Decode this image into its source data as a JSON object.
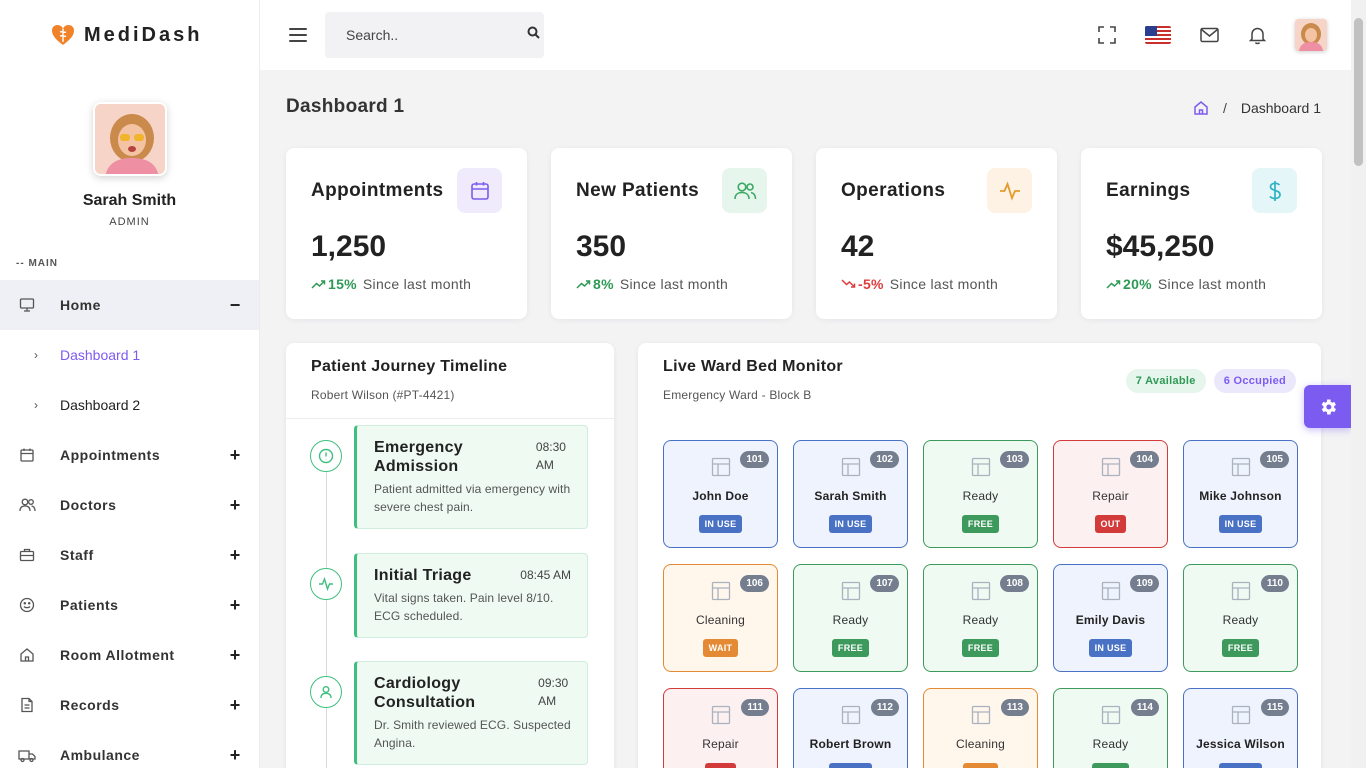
{
  "brand": {
    "name": "MediDash"
  },
  "profile": {
    "name": "Sarah Smith",
    "role": "ADMIN"
  },
  "sidebar": {
    "section_label": "-- MAIN",
    "home": {
      "label": "Home",
      "toggle": "−",
      "sub": [
        {
          "label": "Dashboard 1"
        },
        {
          "label": "Dashboard 2"
        }
      ]
    },
    "items": [
      {
        "label": "Appointments",
        "toggle": "+"
      },
      {
        "label": "Doctors",
        "toggle": "+"
      },
      {
        "label": "Staff",
        "toggle": "+"
      },
      {
        "label": "Patients",
        "toggle": "+"
      },
      {
        "label": "Room Allotment",
        "toggle": "+"
      },
      {
        "label": "Records",
        "toggle": "+"
      },
      {
        "label": "Ambulance",
        "toggle": "+"
      }
    ]
  },
  "header": {
    "search_placeholder": "Search.."
  },
  "page": {
    "title": "Dashboard 1",
    "breadcrumb_current": "Dashboard 1",
    "breadcrumb_sep": "/"
  },
  "stats": [
    {
      "title": "Appointments",
      "value": "1,250",
      "change": "15%",
      "direction": "up",
      "since": "Since last month",
      "icon": "calendar-icon",
      "color": "#7c5cf0",
      "bg": "#efebfd"
    },
    {
      "title": "New Patients",
      "value": "350",
      "change": "8%",
      "direction": "up",
      "since": "Since last month",
      "icon": "users-icon",
      "color": "#3aa865",
      "bg": "#e7f6ec"
    },
    {
      "title": "Operations",
      "value": "42",
      "change": "-5%",
      "direction": "down",
      "since": "Since last month",
      "icon": "activity-icon",
      "color": "#e59a2e",
      "bg": "#fdf2e3"
    },
    {
      "title": "Earnings",
      "value": "$45,250",
      "change": "20%",
      "direction": "up",
      "since": "Since last month",
      "icon": "dollar-icon",
      "color": "#2fb3c4",
      "bg": "#e5f6f8"
    }
  ],
  "timeline": {
    "title": "Patient Journey Timeline",
    "subtitle": "Robert Wilson (#PT-4421)",
    "events": [
      {
        "name": "Emergency Admission",
        "time": "08:30 AM",
        "desc": "Patient admitted via emergency with severe chest pain.",
        "icon": "alert-circle-icon"
      },
      {
        "name": "Initial Triage",
        "time": "08:45 AM",
        "desc": "Vital signs taken. Pain level 8/10. ECG scheduled.",
        "icon": "activity-icon"
      },
      {
        "name": "Cardiology Consultation",
        "time": "09:30 AM",
        "desc": "Dr. Smith reviewed ECG. Suspected Angina.",
        "icon": "user-icon"
      }
    ]
  },
  "ward": {
    "title": "Live Ward Bed Monitor",
    "subtitle": "Emergency Ward - Block B",
    "available": "7 Available",
    "occupied": "6 Occupied",
    "beds": [
      {
        "num": "101",
        "name": "John Doe",
        "status": "IN USE",
        "state": "inuse"
      },
      {
        "num": "102",
        "name": "Sarah Smith",
        "status": "IN USE",
        "state": "inuse"
      },
      {
        "num": "103",
        "name": "Ready",
        "status": "FREE",
        "state": "free"
      },
      {
        "num": "104",
        "name": "Repair",
        "status": "OUT",
        "state": "repair"
      },
      {
        "num": "105",
        "name": "Mike Johnson",
        "status": "IN USE",
        "state": "inuse"
      },
      {
        "num": "106",
        "name": "Cleaning",
        "status": "WAIT",
        "state": "wait"
      },
      {
        "num": "107",
        "name": "Ready",
        "status": "FREE",
        "state": "free"
      },
      {
        "num": "108",
        "name": "Ready",
        "status": "FREE",
        "state": "free"
      },
      {
        "num": "109",
        "name": "Emily Davis",
        "status": "IN USE",
        "state": "inuse"
      },
      {
        "num": "110",
        "name": "Ready",
        "status": "FREE",
        "state": "free"
      },
      {
        "num": "111",
        "name": "Repair",
        "status": "OUT",
        "state": "repair"
      },
      {
        "num": "112",
        "name": "Robert Brown",
        "status": "IN USE",
        "state": "inuse"
      },
      {
        "num": "113",
        "name": "Cleaning",
        "status": "WAIT",
        "state": "wait"
      },
      {
        "num": "114",
        "name": "Ready",
        "status": "FREE",
        "state": "free"
      },
      {
        "num": "115",
        "name": "Jessica Wilson",
        "status": "IN USE",
        "state": "inuse"
      }
    ]
  },
  "colors": {
    "accent": "#7c5cf0"
  }
}
